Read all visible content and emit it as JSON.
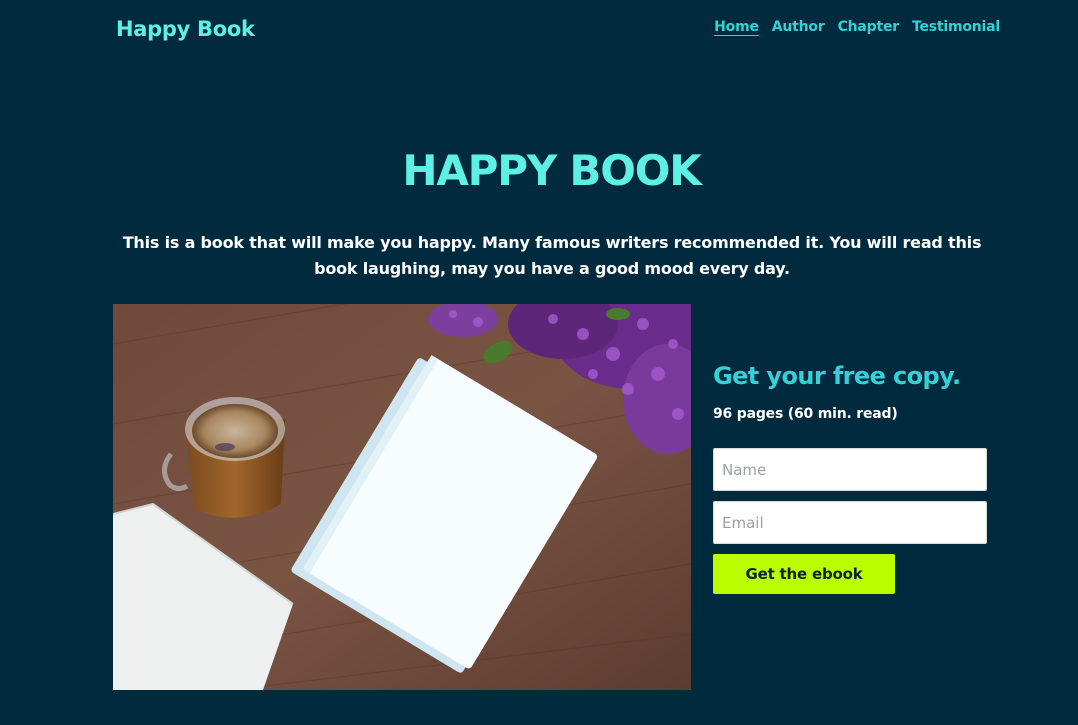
{
  "header": {
    "brand": "Happy Book",
    "nav": [
      {
        "label": "Home"
      },
      {
        "label": "Author"
      },
      {
        "label": "Chapter"
      },
      {
        "label": "Testimonial"
      }
    ]
  },
  "hero": {
    "title": "HAPPY BOOK",
    "description": "This is a book that will make you happy. Many famous writers recommended it. You will read this book laughing, may you have a good mood every day."
  },
  "signup": {
    "title": "Get your free copy.",
    "meta": "96 pages (60 min. read)",
    "name_placeholder": "Name",
    "email_placeholder": "Email",
    "button_label": "Get the ebook"
  },
  "colors": {
    "background": "#002b3f",
    "accent": "#5ef0e4",
    "nav_link": "#34d1d6",
    "cta": "#b9ff00"
  }
}
